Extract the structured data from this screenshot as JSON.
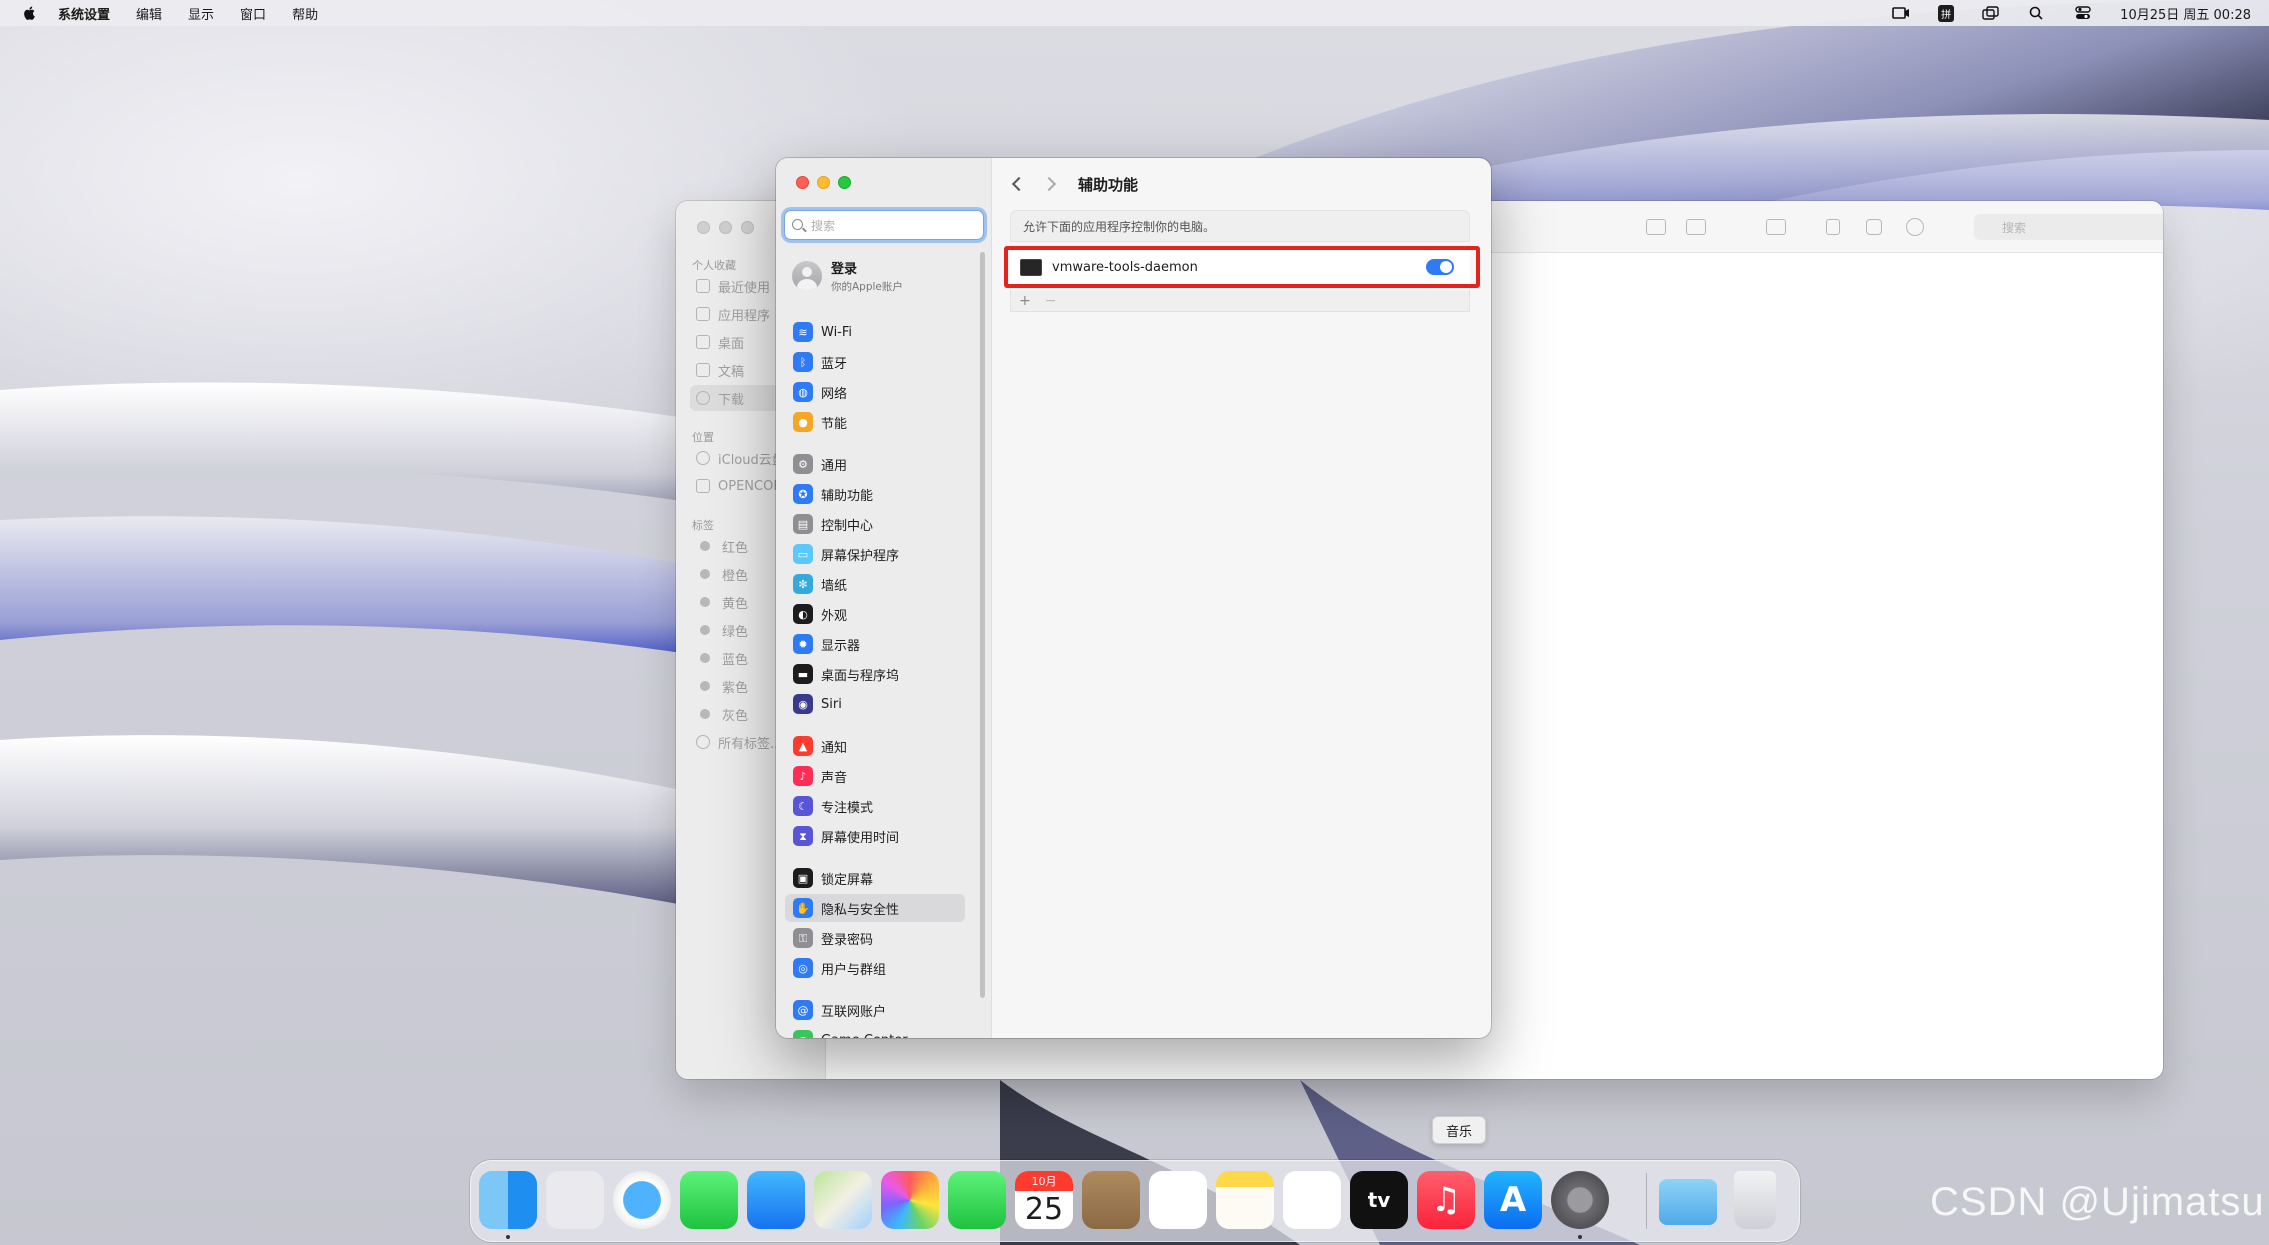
{
  "menubar": {
    "app_name": "系统设置",
    "items": [
      "编辑",
      "显示",
      "窗口",
      "帮助"
    ],
    "ime_label": "拼",
    "datetime": "10月25日 周五 00:28"
  },
  "finder": {
    "sections": {
      "favorites": "个人收藏",
      "locations": "位置",
      "tags": "标签"
    },
    "favorites": [
      "最近使用",
      "应用程序",
      "桌面",
      "文稿",
      "下载"
    ],
    "locations": [
      "iCloud云盘",
      "OPENCORE"
    ],
    "tags": [
      "红色",
      "橙色",
      "黄色",
      "绿色",
      "蓝色",
      "紫色",
      "灰色",
      "所有标签..."
    ],
    "search_placeholder": "搜索"
  },
  "settings": {
    "search_placeholder": "搜索",
    "account": {
      "name": "登录",
      "subtitle": "你的Apple账户"
    },
    "sidebar_items": [
      {
        "label": "Wi-Fi",
        "icon": "wifi-icon",
        "color": "#2f7bf6"
      },
      {
        "label": "蓝牙",
        "icon": "bluetooth-icon",
        "color": "#2f7bf6"
      },
      {
        "label": "网络",
        "icon": "globe-icon",
        "color": "#2f7bf6"
      },
      {
        "label": "节能",
        "icon": "lightbulb-icon",
        "color": "#f5a623"
      },
      {
        "label": "通用",
        "icon": "gear-icon",
        "color": "#8e8e93"
      },
      {
        "label": "辅助功能",
        "icon": "accessibility-icon",
        "color": "#2f7bf6"
      },
      {
        "label": "控制中心",
        "icon": "control-center-icon",
        "color": "#8e8e93"
      },
      {
        "label": "屏幕保护程序",
        "icon": "screensaver-icon",
        "color": "#5ac8fa"
      },
      {
        "label": "墙纸",
        "icon": "wallpaper-icon",
        "color": "#34aadc"
      },
      {
        "label": "外观",
        "icon": "appearance-icon",
        "color": "#1c1c1e"
      },
      {
        "label": "显示器",
        "icon": "display-icon",
        "color": "#2f7bf6"
      },
      {
        "label": "桌面与程序坞",
        "icon": "dock-icon",
        "color": "#1c1c1e"
      },
      {
        "label": "Siri",
        "icon": "siri-icon",
        "color": "#3a3a8c"
      },
      {
        "label": "通知",
        "icon": "bell-icon",
        "color": "#ff3b30"
      },
      {
        "label": "声音",
        "icon": "speaker-icon",
        "color": "#ff2d55"
      },
      {
        "label": "专注模式",
        "icon": "moon-icon",
        "color": "#5856d6"
      },
      {
        "label": "屏幕使用时间",
        "icon": "hourglass-icon",
        "color": "#5856d6"
      },
      {
        "label": "锁定屏幕",
        "icon": "lock-icon",
        "color": "#1c1c1e"
      },
      {
        "label": "隐私与安全性",
        "icon": "hand-icon",
        "color": "#2f7bf6"
      },
      {
        "label": "登录密码",
        "icon": "key-icon",
        "color": "#8e8e93"
      },
      {
        "label": "用户与群组",
        "icon": "users-icon",
        "color": "#2f7bf6"
      },
      {
        "label": "互联网账户",
        "icon": "at-icon",
        "color": "#2f7bf6"
      },
      {
        "label": "Game Center",
        "icon": "game-center-icon",
        "color": "#34c759"
      }
    ],
    "selected_index": 18,
    "page_title": "辅助功能",
    "description": "允许下面的应用程序控制你的电脑。",
    "apps": [
      {
        "name": "vmware-tools-daemon",
        "enabled": true
      }
    ],
    "add_label": "+",
    "remove_label": "−"
  },
  "dock": {
    "tooltip": "音乐",
    "calendar_month": "10月",
    "calendar_day": "25",
    "tv_label": "tv",
    "apps": [
      {
        "icon": "finder-icon",
        "running": true
      },
      {
        "icon": "launchpad-icon",
        "running": false
      },
      {
        "icon": "safari-icon",
        "running": false
      },
      {
        "icon": "messages-icon",
        "running": false
      },
      {
        "icon": "mail-icon",
        "running": false
      },
      {
        "icon": "maps-icon",
        "running": false
      },
      {
        "icon": "photos-icon",
        "running": false
      },
      {
        "icon": "facetime-icon",
        "running": false
      },
      {
        "icon": "calendar-icon",
        "running": false
      },
      {
        "icon": "contacts-icon",
        "running": false
      },
      {
        "icon": "reminders-icon",
        "running": false
      },
      {
        "icon": "notes-icon",
        "running": false
      },
      {
        "icon": "freeform-icon",
        "running": false
      },
      {
        "icon": "apple-tv-icon",
        "running": false
      },
      {
        "icon": "music-icon",
        "running": false
      },
      {
        "icon": "app-store-icon",
        "running": false
      },
      {
        "icon": "system-settings-icon",
        "running": true
      },
      {
        "icon": "downloads-folder-icon",
        "running": false
      },
      {
        "icon": "trash-icon",
        "running": false
      }
    ]
  },
  "watermark": "CSDN @Ujimatsu"
}
